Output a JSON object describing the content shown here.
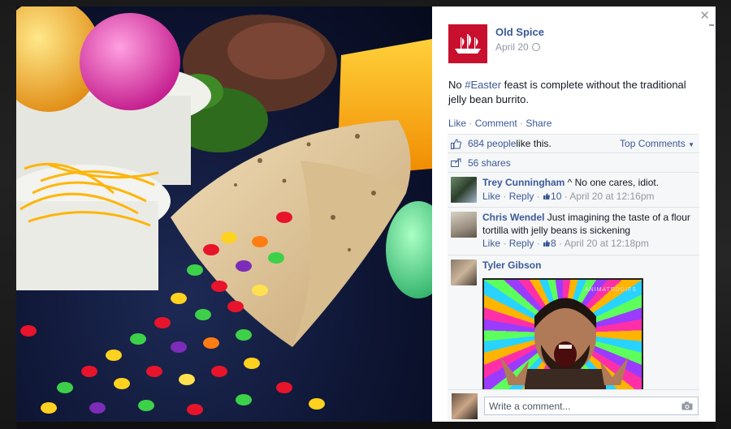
{
  "post": {
    "page_name": "Old Spice",
    "date": "April 20",
    "text_prefix": "No ",
    "hashtag": "#Easter",
    "text_suffix": " feast is complete without the traditional jelly bean burrito."
  },
  "actions": {
    "like": "Like",
    "comment": "Comment",
    "share": "Share",
    "sep": " · "
  },
  "feedback": {
    "likes_count": "684 people",
    "likes_suffix": " like this.",
    "top_comments": "Top Comments",
    "shares": "56 shares"
  },
  "comments": [
    {
      "author": "Trey Cunningham",
      "text": " ^ No one cares, idiot.",
      "like": "Like",
      "reply": "Reply",
      "likes": "10",
      "time": "April 20 at 12:16pm"
    },
    {
      "author": "Chris Wendel",
      "text": " Just imagining the taste of a flour tortilla with jelly beans is sickening",
      "like": "Like",
      "reply": "Reply",
      "likes": "8",
      "time": "April 20 at 12:18pm"
    },
    {
      "author": "Tyler Gibson",
      "meme_watermark": "ANIMATEDGIFS"
    }
  ],
  "composer": {
    "placeholder": "Write a comment..."
  },
  "colors": {
    "link": "#3b5998",
    "brand_red": "#c8102e",
    "panel_bg": "#f6f7f8"
  },
  "icons": [
    "close-icon",
    "globe-icon",
    "thumbs-up-icon",
    "share-icon",
    "camera-icon"
  ]
}
